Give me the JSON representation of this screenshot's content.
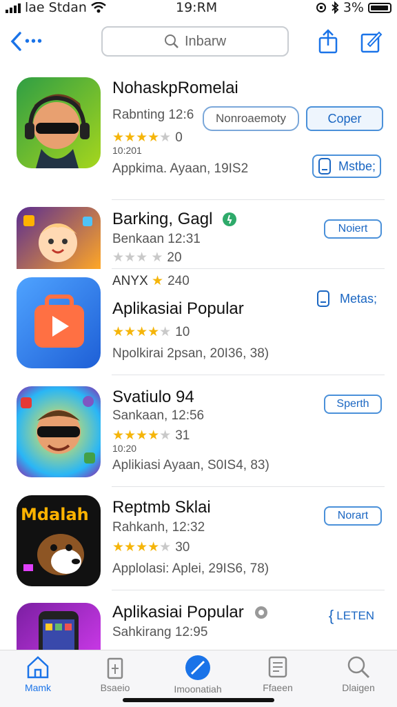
{
  "status_bar": {
    "carrier": "lae Stdan",
    "time": "19:RM",
    "battery": "3%"
  },
  "nav": {
    "search_placeholder": "Inbarw"
  },
  "apps": [
    {
      "title": "NohaskpRomelai",
      "subtitle": "Rabnting 12:6",
      "stars": 4,
      "rating_count": "0",
      "small_text": "10:201",
      "meta": "Appkima. Ayaan, 19IS2",
      "btn_primary": "Coper",
      "btn_secondary": "Nonroaemoty",
      "btn_side": "Mstbe;"
    },
    {
      "title": "Barking, Gagl",
      "subtitle": "Benkaan 12:31",
      "stars": 0,
      "rating_count": "20",
      "btn_side": "Noiert"
    },
    {
      "title": "Aplikasiai Popular",
      "pre_text": "ANYX",
      "pre_rating": "240",
      "stars": 4,
      "rating_count": "10",
      "meta": "Npolkirai 2psan, 20I36, 38)",
      "btn_side": "Metas;"
    },
    {
      "title": "Svatiulo 94",
      "subtitle": "Sankaan, 12:56",
      "stars": 4,
      "rating_count": "31",
      "small_text": "10:20",
      "meta": "Aplikiasi Ayaan, S0IS4, 83)",
      "btn_side": "Sperth"
    },
    {
      "title": "Reptmb Sklai",
      "subtitle": "Rahkanh, 12:32",
      "stars": 4,
      "rating_count": "30",
      "meta": "Applolasi: Aplei, 29IS6, 78)",
      "btn_side": "Norart"
    },
    {
      "title": "Aplikasiai Popular",
      "subtitle": "Sahkirang 12:95",
      "btn_side": "LETEN"
    }
  ],
  "tabs": [
    {
      "label": "Mamk",
      "icon": "home-icon",
      "active": true
    },
    {
      "label": "Bsaeio",
      "icon": "document-icon",
      "active": false
    },
    {
      "label": "Imoonatiah",
      "icon": "compass-icon",
      "active": false
    },
    {
      "label": "Ffaeen",
      "icon": "book-icon",
      "active": false
    },
    {
      "label": "Dlaigen",
      "icon": "search-icon",
      "active": false
    }
  ],
  "colors": {
    "accent": "#1a73e8",
    "star": "#f5b50a"
  }
}
